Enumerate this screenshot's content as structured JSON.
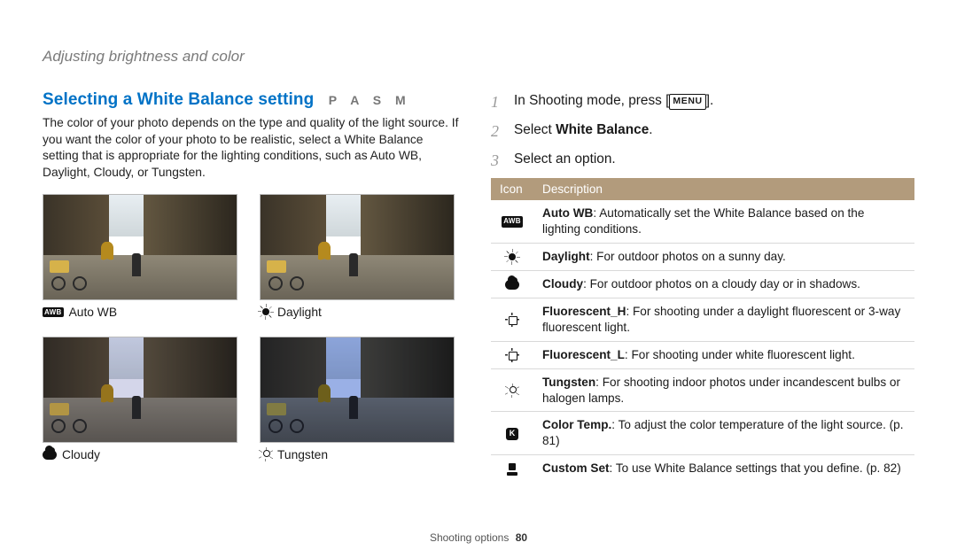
{
  "breadcrumb": "Adjusting brightness and color",
  "heading": {
    "title": "Selecting a White Balance setting",
    "modes": "P A S M"
  },
  "intro": "The color of your photo depends on the type and quality of the light source. If you want the color of your photo to be realistic, select a White Balance setting that is appropriate for the lighting conditions, such as Auto WB, Daylight, Cloudy, or Tungsten.",
  "thumbs": {
    "auto": {
      "label": "Auto WB",
      "icon": "awb-icon"
    },
    "day": {
      "label": "Daylight",
      "icon": "sun-icon"
    },
    "cloud": {
      "label": "Cloudy",
      "icon": "cloud-icon"
    },
    "tung": {
      "label": "Tungsten",
      "icon": "tungsten-icon"
    }
  },
  "steps": {
    "s1_pre": "In Shooting mode, press [",
    "s1_btn": "MENU",
    "s1_post": "].",
    "s2_pre": "Select ",
    "s2_bold": "White Balance",
    "s2_post": ".",
    "s3": "Select an option."
  },
  "table": {
    "head_icon": "Icon",
    "head_desc": "Description",
    "rows": [
      {
        "icon": "awb-icon",
        "bold": "Auto WB",
        "text": ": Automatically set the White Balance based on the lighting conditions."
      },
      {
        "icon": "sun-icon",
        "bold": "Daylight",
        "text": ": For outdoor photos on a sunny day."
      },
      {
        "icon": "cloud-icon",
        "bold": "Cloudy",
        "text": ": For outdoor photos on a cloudy day or in shadows."
      },
      {
        "icon": "fluorescent-h-icon",
        "bold": "Fluorescent_H",
        "text": ": For shooting under a daylight fluorescent or 3-way fluorescent light."
      },
      {
        "icon": "fluorescent-l-icon",
        "bold": "Fluorescent_L",
        "text": ": For shooting under white fluorescent light."
      },
      {
        "icon": "tungsten-icon",
        "bold": "Tungsten",
        "text": ": For shooting indoor photos under incandescent bulbs or halogen lamps."
      },
      {
        "icon": "kelvin-icon",
        "bold": "Color Temp.",
        "text": ": To adjust the color temperature of the light source. (p. 81)"
      },
      {
        "icon": "custom-icon",
        "bold": "Custom Set",
        "text": ": To use White Balance settings that you define. (p. 82)"
      }
    ]
  },
  "footer": {
    "section": "Shooting options",
    "page": "80"
  }
}
